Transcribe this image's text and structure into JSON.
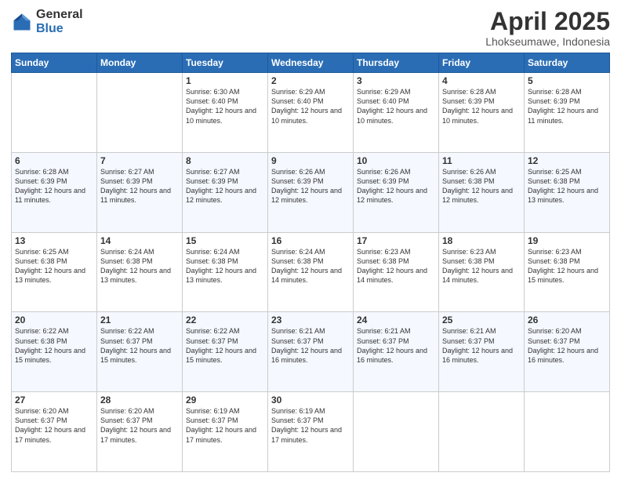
{
  "header": {
    "logo_general": "General",
    "logo_blue": "Blue",
    "title": "April 2025",
    "location": "Lhokseumawe, Indonesia"
  },
  "days_of_week": [
    "Sunday",
    "Monday",
    "Tuesday",
    "Wednesday",
    "Thursday",
    "Friday",
    "Saturday"
  ],
  "weeks": [
    [
      {
        "day": "",
        "info": ""
      },
      {
        "day": "",
        "info": ""
      },
      {
        "day": "1",
        "info": "Sunrise: 6:30 AM\nSunset: 6:40 PM\nDaylight: 12 hours and 10 minutes."
      },
      {
        "day": "2",
        "info": "Sunrise: 6:29 AM\nSunset: 6:40 PM\nDaylight: 12 hours and 10 minutes."
      },
      {
        "day": "3",
        "info": "Sunrise: 6:29 AM\nSunset: 6:40 PM\nDaylight: 12 hours and 10 minutes."
      },
      {
        "day": "4",
        "info": "Sunrise: 6:28 AM\nSunset: 6:39 PM\nDaylight: 12 hours and 10 minutes."
      },
      {
        "day": "5",
        "info": "Sunrise: 6:28 AM\nSunset: 6:39 PM\nDaylight: 12 hours and 11 minutes."
      }
    ],
    [
      {
        "day": "6",
        "info": "Sunrise: 6:28 AM\nSunset: 6:39 PM\nDaylight: 12 hours and 11 minutes."
      },
      {
        "day": "7",
        "info": "Sunrise: 6:27 AM\nSunset: 6:39 PM\nDaylight: 12 hours and 11 minutes."
      },
      {
        "day": "8",
        "info": "Sunrise: 6:27 AM\nSunset: 6:39 PM\nDaylight: 12 hours and 12 minutes."
      },
      {
        "day": "9",
        "info": "Sunrise: 6:26 AM\nSunset: 6:39 PM\nDaylight: 12 hours and 12 minutes."
      },
      {
        "day": "10",
        "info": "Sunrise: 6:26 AM\nSunset: 6:39 PM\nDaylight: 12 hours and 12 minutes."
      },
      {
        "day": "11",
        "info": "Sunrise: 6:26 AM\nSunset: 6:38 PM\nDaylight: 12 hours and 12 minutes."
      },
      {
        "day": "12",
        "info": "Sunrise: 6:25 AM\nSunset: 6:38 PM\nDaylight: 12 hours and 13 minutes."
      }
    ],
    [
      {
        "day": "13",
        "info": "Sunrise: 6:25 AM\nSunset: 6:38 PM\nDaylight: 12 hours and 13 minutes."
      },
      {
        "day": "14",
        "info": "Sunrise: 6:24 AM\nSunset: 6:38 PM\nDaylight: 12 hours and 13 minutes."
      },
      {
        "day": "15",
        "info": "Sunrise: 6:24 AM\nSunset: 6:38 PM\nDaylight: 12 hours and 13 minutes."
      },
      {
        "day": "16",
        "info": "Sunrise: 6:24 AM\nSunset: 6:38 PM\nDaylight: 12 hours and 14 minutes."
      },
      {
        "day": "17",
        "info": "Sunrise: 6:23 AM\nSunset: 6:38 PM\nDaylight: 12 hours and 14 minutes."
      },
      {
        "day": "18",
        "info": "Sunrise: 6:23 AM\nSunset: 6:38 PM\nDaylight: 12 hours and 14 minutes."
      },
      {
        "day": "19",
        "info": "Sunrise: 6:23 AM\nSunset: 6:38 PM\nDaylight: 12 hours and 15 minutes."
      }
    ],
    [
      {
        "day": "20",
        "info": "Sunrise: 6:22 AM\nSunset: 6:38 PM\nDaylight: 12 hours and 15 minutes."
      },
      {
        "day": "21",
        "info": "Sunrise: 6:22 AM\nSunset: 6:37 PM\nDaylight: 12 hours and 15 minutes."
      },
      {
        "day": "22",
        "info": "Sunrise: 6:22 AM\nSunset: 6:37 PM\nDaylight: 12 hours and 15 minutes."
      },
      {
        "day": "23",
        "info": "Sunrise: 6:21 AM\nSunset: 6:37 PM\nDaylight: 12 hours and 16 minutes."
      },
      {
        "day": "24",
        "info": "Sunrise: 6:21 AM\nSunset: 6:37 PM\nDaylight: 12 hours and 16 minutes."
      },
      {
        "day": "25",
        "info": "Sunrise: 6:21 AM\nSunset: 6:37 PM\nDaylight: 12 hours and 16 minutes."
      },
      {
        "day": "26",
        "info": "Sunrise: 6:20 AM\nSunset: 6:37 PM\nDaylight: 12 hours and 16 minutes."
      }
    ],
    [
      {
        "day": "27",
        "info": "Sunrise: 6:20 AM\nSunset: 6:37 PM\nDaylight: 12 hours and 17 minutes."
      },
      {
        "day": "28",
        "info": "Sunrise: 6:20 AM\nSunset: 6:37 PM\nDaylight: 12 hours and 17 minutes."
      },
      {
        "day": "29",
        "info": "Sunrise: 6:19 AM\nSunset: 6:37 PM\nDaylight: 12 hours and 17 minutes."
      },
      {
        "day": "30",
        "info": "Sunrise: 6:19 AM\nSunset: 6:37 PM\nDaylight: 12 hours and 17 minutes."
      },
      {
        "day": "",
        "info": ""
      },
      {
        "day": "",
        "info": ""
      },
      {
        "day": "",
        "info": ""
      }
    ]
  ]
}
